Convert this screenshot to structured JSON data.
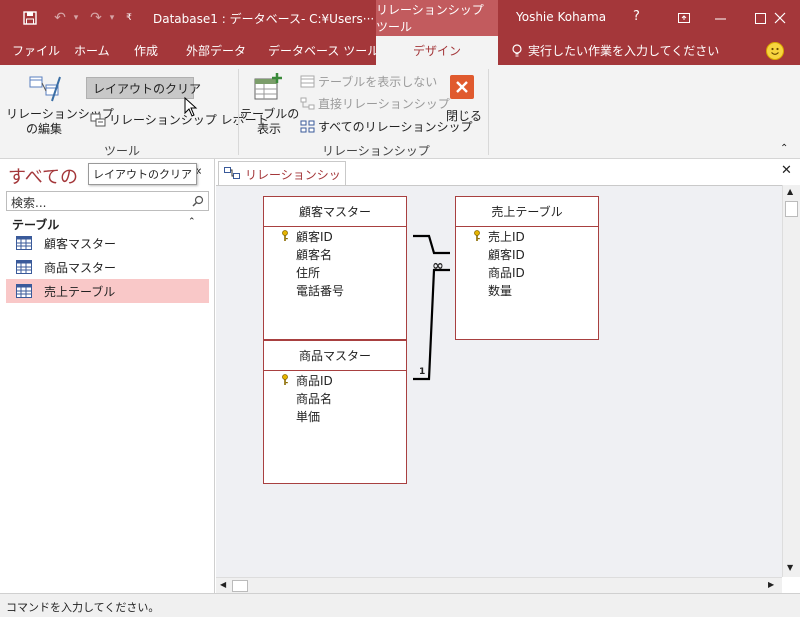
{
  "titlebar": {
    "title": "Database1 : データベース- C:¥Users···",
    "context_tools": "リレーションシップ ツール",
    "user": "Yoshie Kohama",
    "help": "?"
  },
  "tabs": {
    "file": "ファイル",
    "home": "ホーム",
    "create": "作成",
    "external_data": "外部データ",
    "database_tools": "データベース ツール",
    "design": "デザイン",
    "tell_me": "実行したい作業を入力してください"
  },
  "ribbon": {
    "edit_relationships": [
      "リレーションシップ",
      "の編集"
    ],
    "clear_layout": "レイアウトのクリア",
    "relationship_report": "リレーションシップ レポート",
    "tools_group": "ツール",
    "show_table": [
      "テーブルの",
      "表示"
    ],
    "hide_table": "テーブルを表示しない",
    "direct_relationships": "直接リレーションシップ",
    "all_relationships": "すべてのリレーションシップ",
    "close": "閉じる",
    "relationships_group": "リレーションシップ",
    "tooltip": "レイアウトのクリア"
  },
  "nav": {
    "header": "すべての",
    "tooltip": "レイアウトのクリア",
    "search_placeholder": "検索...",
    "category": "テーブル",
    "items": [
      {
        "label": "顧客マスター",
        "selected": false
      },
      {
        "label": "商品マスター",
        "selected": false
      },
      {
        "label": "売上テーブル",
        "selected": true
      }
    ]
  },
  "doc": {
    "tab_label": "リレーションシップ",
    "tables": [
      {
        "name": "顧客マスター",
        "fields": [
          "顧客ID",
          "顧客名",
          "住所",
          "電話番号"
        ],
        "key": 0
      },
      {
        "name": "売上テーブル",
        "fields": [
          "売上ID",
          "顧客ID",
          "商品ID",
          "数量"
        ],
        "key": 0
      },
      {
        "name": "商品マスター",
        "fields": [
          "商品ID",
          "商品名",
          "単価"
        ],
        "key": 0
      }
    ],
    "relation_one": "1",
    "relation_many": "∞"
  },
  "status": {
    "text": "コマンドを入力してください。"
  },
  "colors": {
    "accent": "#a4373a",
    "selected_item": "#f9c8c8",
    "table_border": "#a84040",
    "canvas_bg": "#eff0f3"
  }
}
